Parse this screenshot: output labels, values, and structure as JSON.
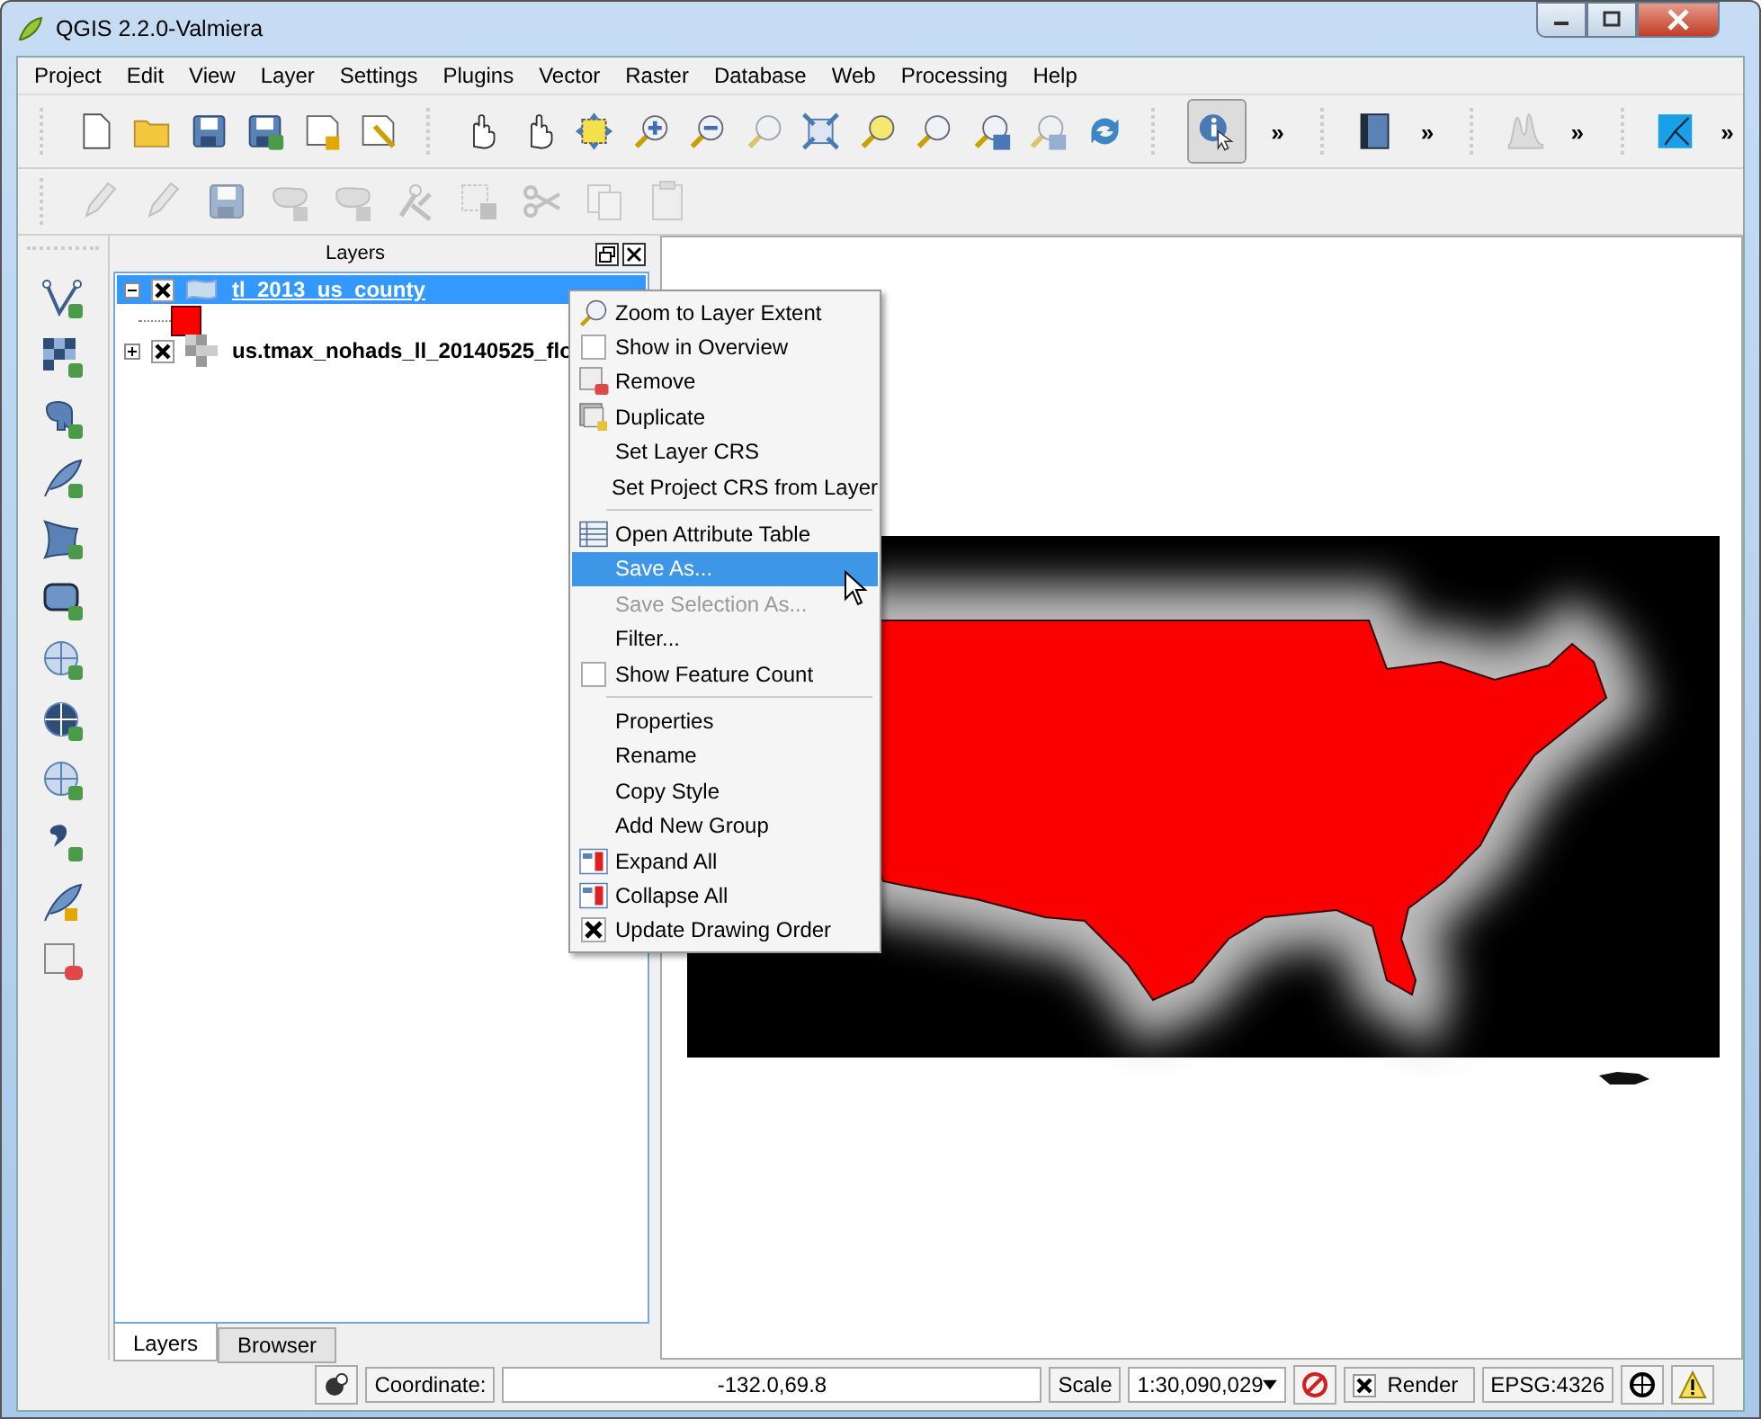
{
  "window": {
    "title": "QGIS 2.2.0-Valmiera"
  },
  "menu_bar": [
    "Project",
    "Edit",
    "View",
    "Layer",
    "Settings",
    "Plugins",
    "Vector",
    "Raster",
    "Database",
    "Web",
    "Processing",
    "Help"
  ],
  "toolbar_overflow": [
    "»",
    "»",
    "»",
    "»"
  ],
  "layers_panel": {
    "title": "Layers",
    "layers": [
      {
        "name": "tl_2013_us_county",
        "checked": true,
        "expanded": true,
        "selected": true
      },
      {
        "name": "us.tmax_nohads_ll_20140525_flo",
        "checked": true,
        "expanded": false,
        "selected": false
      }
    ]
  },
  "panel_tabs": [
    {
      "label": "Layers",
      "selected": true
    },
    {
      "label": "Browser",
      "selected": false
    }
  ],
  "context_menu": {
    "items": [
      {
        "kind": "action",
        "label": "Zoom to Layer Extent",
        "selected": false,
        "disabled": false
      },
      {
        "kind": "checkbox",
        "label": "Show in Overview",
        "checked": false,
        "selected": false,
        "disabled": false
      },
      {
        "kind": "action",
        "label": "Remove",
        "selected": false,
        "disabled": false
      },
      {
        "kind": "action",
        "label": "Duplicate",
        "selected": false,
        "disabled": false
      },
      {
        "kind": "action",
        "label": "Set Layer CRS",
        "selected": false,
        "disabled": false
      },
      {
        "kind": "action",
        "label": "Set Project CRS from Layer",
        "selected": false,
        "disabled": false
      },
      {
        "kind": "separator"
      },
      {
        "kind": "action",
        "label": "Open Attribute Table",
        "selected": false,
        "disabled": false
      },
      {
        "kind": "action",
        "label": "Save As...",
        "selected": true,
        "disabled": false
      },
      {
        "kind": "action",
        "label": "Save Selection As...",
        "selected": false,
        "disabled": true
      },
      {
        "kind": "action",
        "label": "Filter...",
        "selected": false,
        "disabled": false
      },
      {
        "kind": "checkbox",
        "label": "Show Feature Count",
        "checked": false,
        "selected": false,
        "disabled": false
      },
      {
        "kind": "separator"
      },
      {
        "kind": "action",
        "label": "Properties",
        "selected": false,
        "disabled": false
      },
      {
        "kind": "action",
        "label": "Rename",
        "selected": false,
        "disabled": false
      },
      {
        "kind": "action",
        "label": "Copy Style",
        "selected": false,
        "disabled": false
      },
      {
        "kind": "action",
        "label": "Add New Group",
        "selected": false,
        "disabled": false
      },
      {
        "kind": "action",
        "label": "Expand All",
        "selected": false,
        "disabled": false
      },
      {
        "kind": "action",
        "label": "Collapse All",
        "selected": false,
        "disabled": false
      },
      {
        "kind": "checkbox",
        "label": "Update Drawing Order",
        "checked": true,
        "selected": false,
        "disabled": false
      }
    ]
  },
  "status_bar": {
    "coordinate_label": "Coordinate:",
    "coordinate_value": "-132.0,69.8",
    "scale_label": "Scale",
    "scale_value": "1:30,090,029",
    "render": {
      "label": "Render",
      "checked": true
    },
    "crs": "EPSG:4326"
  }
}
